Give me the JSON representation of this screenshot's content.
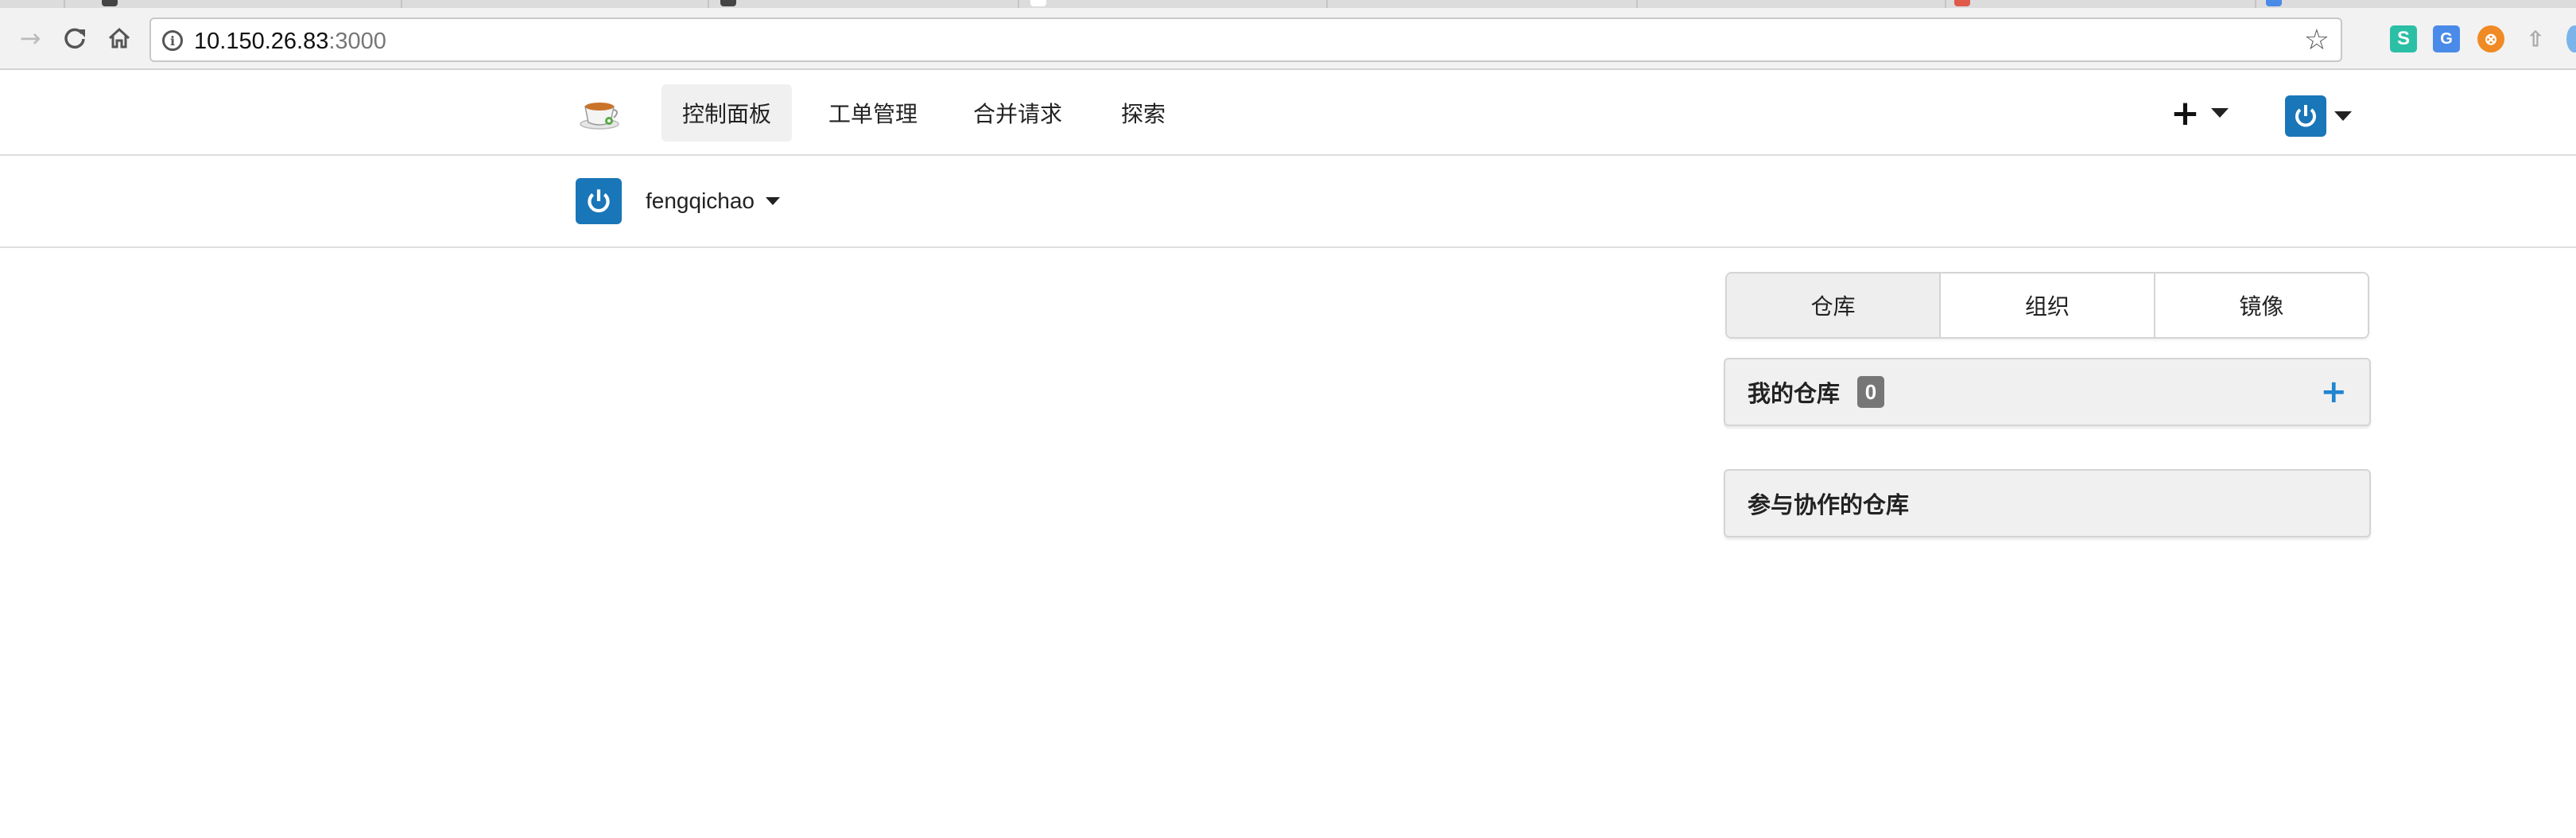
{
  "browser": {
    "url_host": "10.150.26.83",
    "url_port": ":3000",
    "back_icon": "arrow-right-icon",
    "reload_icon": "reload-icon",
    "home_icon": "home-icon",
    "bookmark_icon": "star-icon",
    "extensions": [
      {
        "name": "s-extension-icon",
        "glyph": "S"
      },
      {
        "name": "translate-extension-icon",
        "glyph": "G"
      },
      {
        "name": "orange-extension-icon",
        "glyph": "⊗"
      },
      {
        "name": "upload-extension-icon",
        "glyph": "⇧"
      }
    ]
  },
  "header": {
    "logo_icon": "gitea-tea-cup-icon",
    "nav": [
      {
        "label": "控制面板",
        "active": true
      },
      {
        "label": "工单管理",
        "active": false
      },
      {
        "label": "合并请求",
        "active": false
      },
      {
        "label": "探索",
        "active": false
      }
    ],
    "create_label": "+",
    "user_avatar_icon": "power-avatar-icon"
  },
  "context": {
    "username": "fengqichao"
  },
  "dashboard": {
    "tabs": [
      {
        "label": "仓库",
        "active": true
      },
      {
        "label": "组织",
        "active": false
      },
      {
        "label": "镜像",
        "active": false
      }
    ],
    "my_repos": {
      "title": "我的仓库",
      "count": "0",
      "add_icon": "plus-icon"
    },
    "collab_repos": {
      "title": "参与协作的仓库"
    }
  },
  "colors": {
    "accent": "#2185d0",
    "avatar": "#1976b8",
    "badge": "#767676",
    "panel_bg": "#f0f0f0"
  }
}
